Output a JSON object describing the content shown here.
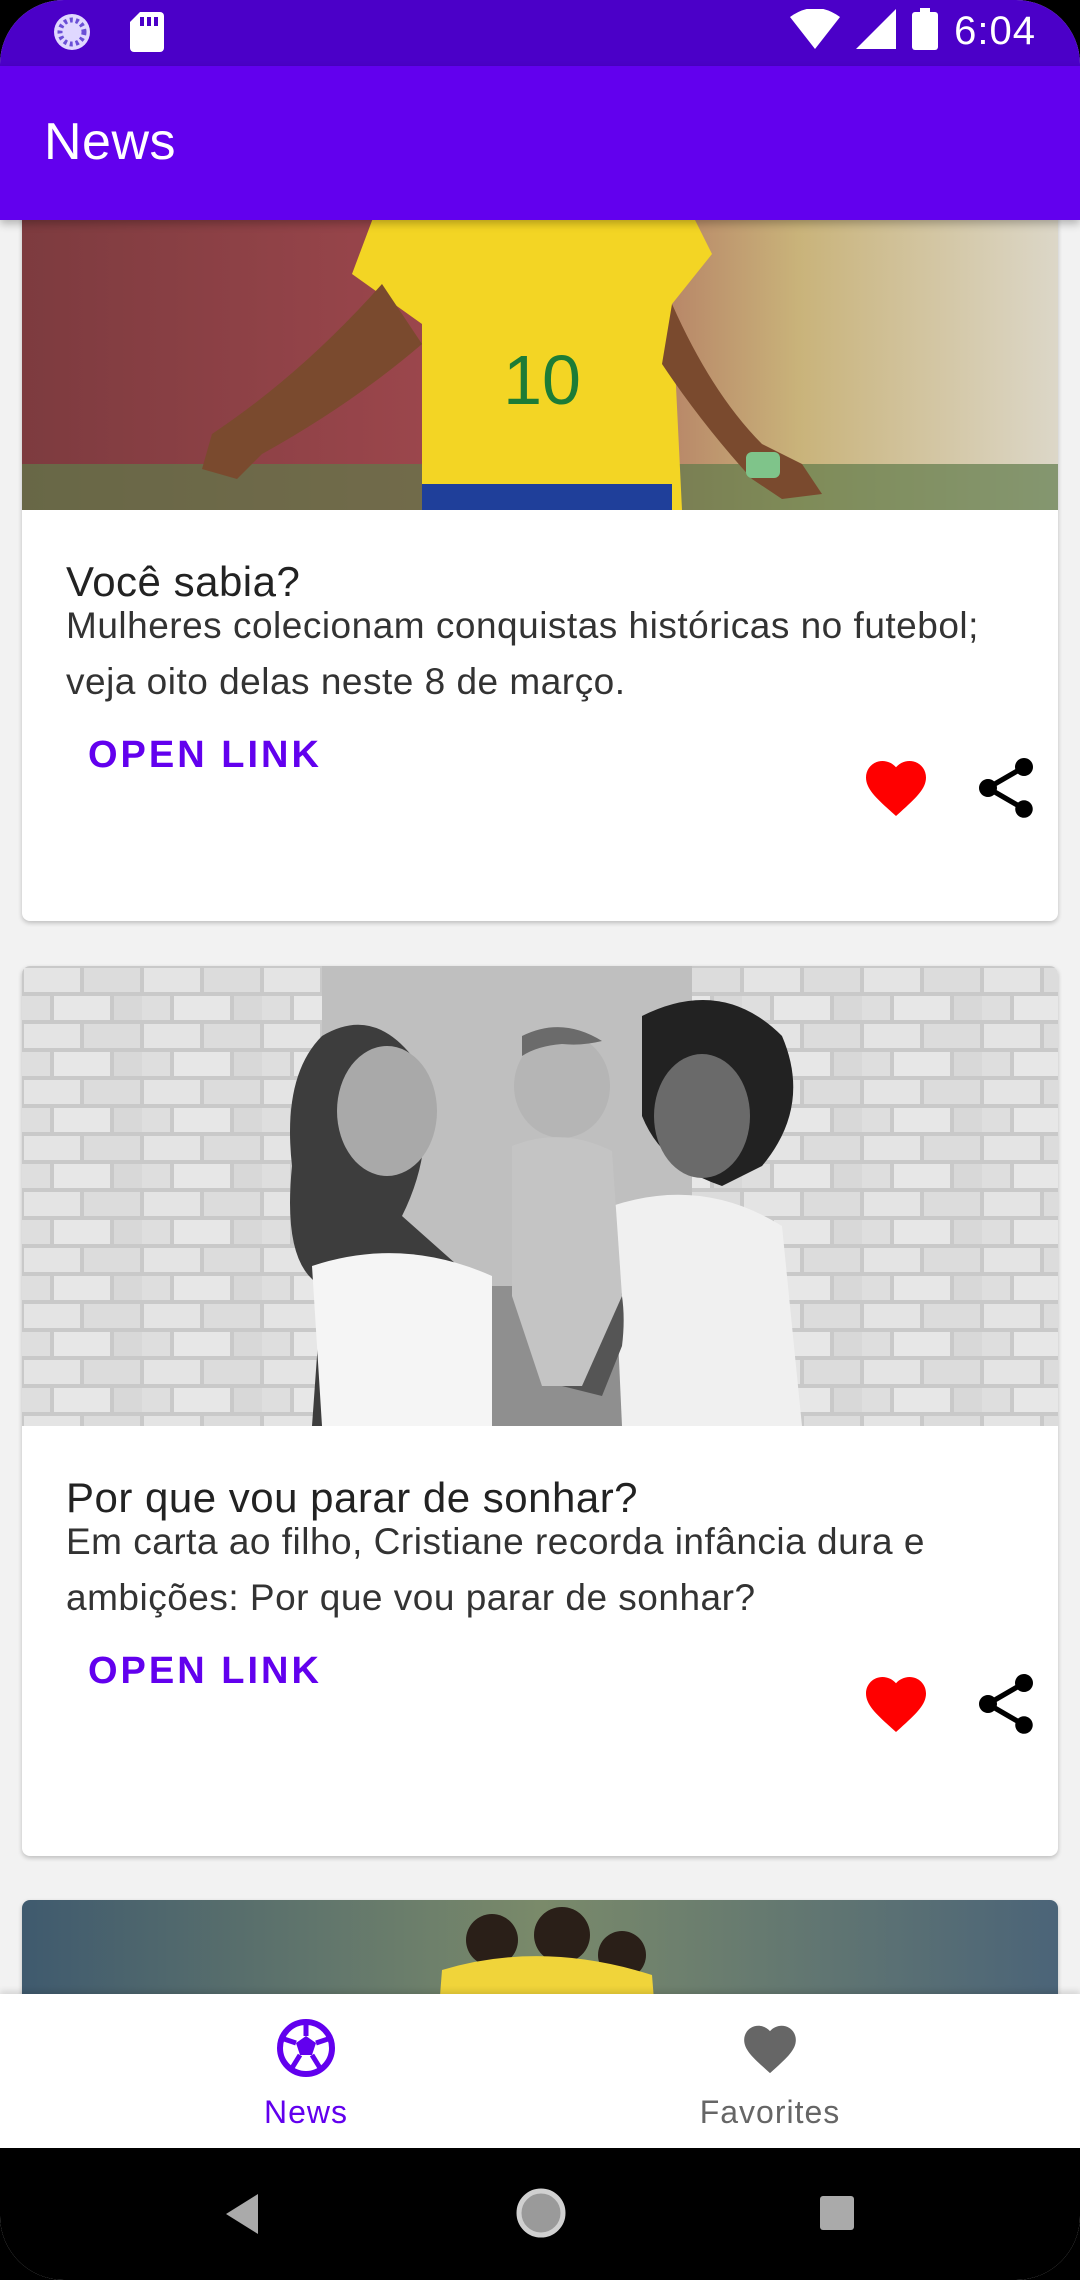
{
  "status_bar": {
    "time": "6:04",
    "icons": [
      "sync-icon",
      "sd-card-icon",
      "wifi-icon",
      "signal-icon",
      "battery-icon"
    ]
  },
  "app_bar": {
    "title": "News"
  },
  "news_items": [
    {
      "title": "Você sabia?",
      "description": "Mulheres colecionam conquistas históricas no futebol; veja oito delas neste 8 de março.",
      "open_link_label": "OPEN LINK",
      "favorited": true,
      "media": "photo-soccer-player-yellow-jersey-10"
    },
    {
      "title": "Por que vou parar de sonhar?",
      "description": "Em carta ao filho, Cristiane recorda infância dura e ambições: Por que vou parar de sonhar?",
      "open_link_label": "OPEN LINK",
      "favorited": true,
      "media": "photo-family-black-and-white"
    },
    {
      "media": "photo-team-celebration"
    }
  ],
  "bottom_nav": {
    "items": [
      {
        "label": "News",
        "icon": "soccer-ball-icon",
        "selected": true
      },
      {
        "label": "Favorites",
        "icon": "heart-icon",
        "selected": false
      }
    ]
  },
  "colors": {
    "primary": "#6200ee",
    "status_bar": "#4b00c8",
    "favorite": "#ff0000",
    "nav_inactive": "#666666"
  }
}
